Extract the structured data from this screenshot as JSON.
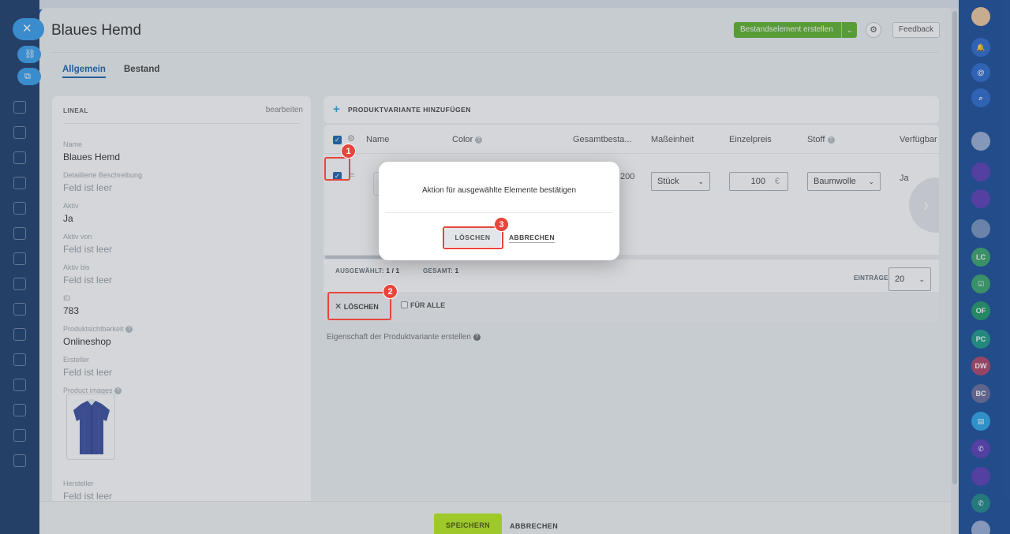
{
  "page": {
    "title": "Blaues Hemd",
    "create_button": "Bestandselement erstellen",
    "feedback_button": "Feedback",
    "tabs": [
      {
        "label": "Allgemein",
        "active": true
      },
      {
        "label": "Bestand",
        "active": false
      }
    ]
  },
  "product_card": {
    "header": "LINEAL",
    "edit_link": "bearbeiten",
    "fields": [
      {
        "label": "Name",
        "value": "Blaues Hemd",
        "empty": false
      },
      {
        "label": "Detaillierte Beschreibung",
        "value": "Feld ist leer",
        "empty": true
      },
      {
        "label": "Aktiv",
        "value": "Ja",
        "empty": false
      },
      {
        "label": "Aktiv von",
        "value": "Feld ist leer",
        "empty": true
      },
      {
        "label": "Aktiv bis",
        "value": "Feld ist leer",
        "empty": true
      },
      {
        "label": "ID",
        "value": "783",
        "empty": false
      },
      {
        "label": "Produktsichtbarkeit",
        "value": "Onlineshop",
        "empty": false
      },
      {
        "label": "Ersteller",
        "value": "Feld ist leer",
        "empty": true
      },
      {
        "label": "Product images",
        "value": "",
        "empty": false
      },
      {
        "label": "Hersteller",
        "value": "Feld ist leer",
        "empty": true
      }
    ]
  },
  "variants": {
    "add_label": "PRODUKTVARIANTE HINZUFÜGEN",
    "columns": [
      "Name",
      "Color",
      "Gesamtbesta...",
      "Maßeinheit",
      "Einzelpreis",
      "Stoff",
      "Verfügbar"
    ],
    "row": {
      "stock_partial": "200",
      "unit": "Stück",
      "price": "100",
      "currency": "€",
      "fabric": "Baumwolle",
      "available": "Ja"
    },
    "footer": {
      "selected_label": "AUSGEWÄHLT:",
      "selected_value": "1 / 1",
      "total_label": "GESAMT:",
      "total_value": "1",
      "entries_label": "EINTRÄGE",
      "entries_value": "20"
    },
    "delete_label": "LÖSCHEN",
    "for_all_label": "FÜR ALLE",
    "create_property_link": "Eigenschaft der Produktvariante erstellen"
  },
  "bottom": {
    "save": "SPEICHERN",
    "cancel": "ABBRECHEN"
  },
  "modal": {
    "message": "Aktion für ausgewählte Elemente bestätigen",
    "delete": "LÖSCHEN",
    "cancel": "ABBRECHEN"
  },
  "annotations": {
    "step1": "1",
    "step2": "2",
    "step3": "3"
  },
  "right_bar": {
    "avatars": [
      "LC",
      "OF",
      "PC",
      "DW",
      "BC"
    ]
  },
  "colors": {
    "accent_blue": "#2067b0",
    "create_green": "#60b531",
    "save_lime": "#bbed21",
    "annotation_red": "#e8453c"
  }
}
